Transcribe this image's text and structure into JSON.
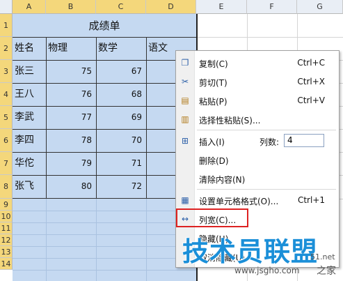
{
  "columns": [
    "A",
    "B",
    "C",
    "D",
    "E",
    "F",
    "G"
  ],
  "rows": [
    "1",
    "2",
    "3",
    "4",
    "5",
    "6",
    "7",
    "8",
    "9",
    "10",
    "11",
    "12",
    "13",
    "14"
  ],
  "table": {
    "title": "成绩单",
    "headers": [
      "姓名",
      "物理",
      "数学",
      "语文"
    ],
    "data": [
      {
        "name": "张三",
        "physics": "75",
        "math": "67"
      },
      {
        "name": "王八",
        "physics": "76",
        "math": "68"
      },
      {
        "name": "李武",
        "physics": "77",
        "math": "69"
      },
      {
        "name": "李四",
        "physics": "78",
        "math": "70"
      },
      {
        "name": "华佗",
        "physics": "79",
        "math": "71"
      },
      {
        "name": "张飞",
        "physics": "80",
        "math": "72"
      }
    ]
  },
  "context_menu": {
    "copy": {
      "label": "复制(C)",
      "shortcut": "Ctrl+C",
      "icon": "copy-icon"
    },
    "cut": {
      "label": "剪切(T)",
      "shortcut": "Ctrl+X",
      "icon": "scissors-icon"
    },
    "paste": {
      "label": "粘贴(P)",
      "shortcut": "Ctrl+V",
      "icon": "paste-icon"
    },
    "paste_special": {
      "label": "选择性粘贴(S)...",
      "icon": "paste-special-icon"
    },
    "insert": {
      "label": "插入(I)",
      "count_label": "列数:",
      "count_value": "4",
      "icon": "insert-column-icon"
    },
    "delete": {
      "label": "删除(D)"
    },
    "clear": {
      "label": "清除内容(N)"
    },
    "format_cells": {
      "label": "设置单元格格式(O)...",
      "shortcut": "Ctrl+1",
      "icon": "format-cells-icon"
    },
    "column_width": {
      "label": "列宽(C)...",
      "icon": "column-width-icon"
    },
    "hide": {
      "label": "隐藏(H)"
    },
    "unhide": {
      "label": "取消隐藏(U)"
    }
  },
  "watermark": {
    "main": "技术员联盟",
    "url": "www.jsgho.com",
    "side1": "51.net",
    "side2": "之家"
  },
  "colors": {
    "selection": "#c5d9f1",
    "header_selected": "#f4d77b",
    "highlight": "#dd2222",
    "watermark": "#1b8fd8"
  }
}
